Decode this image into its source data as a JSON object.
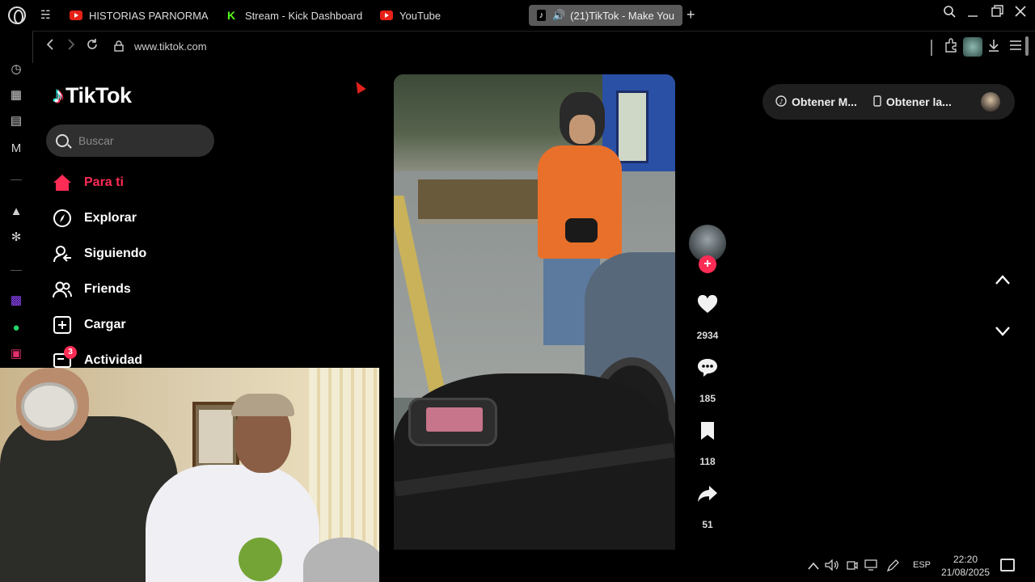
{
  "browser": {
    "tabs": [
      {
        "label": "HISTORIAS PARNORMALE",
        "icon": "youtube-icon"
      },
      {
        "label": "Stream - Kick Dashboard",
        "icon": "kick-icon"
      },
      {
        "label": "YouTube",
        "icon": "youtube-icon"
      },
      {
        "label": "(21)TikTok - Make You",
        "icon": "tiktok-icon",
        "active": true
      }
    ],
    "url": "www.tiktok.com"
  },
  "tiktok": {
    "logo": "TikTok",
    "search_placeholder": "Buscar",
    "nav": [
      {
        "label": "Para ti",
        "icon": "home-icon",
        "active": true
      },
      {
        "label": "Explorar",
        "icon": "compass-icon"
      },
      {
        "label": "Siguiendo",
        "icon": "following-icon"
      },
      {
        "label": "Friends",
        "icon": "friends-icon"
      },
      {
        "label": "Cargar",
        "icon": "upload-icon"
      },
      {
        "label": "Actividad",
        "icon": "inbox-icon",
        "badge": "3"
      }
    ],
    "get_app": {
      "item1": "Obtener M...",
      "item2": "Obtener la..."
    },
    "actions": {
      "likes": "2934",
      "comments": "185",
      "saves": "118",
      "shares": "51"
    },
    "follow_symbol": "+"
  },
  "taskbar": {
    "language": "ESP",
    "time": "22:20",
    "date": "21/08/2025"
  },
  "colors": {
    "accent": "#fe2c55",
    "background": "#000000",
    "search_bg": "#2f2f2f"
  }
}
